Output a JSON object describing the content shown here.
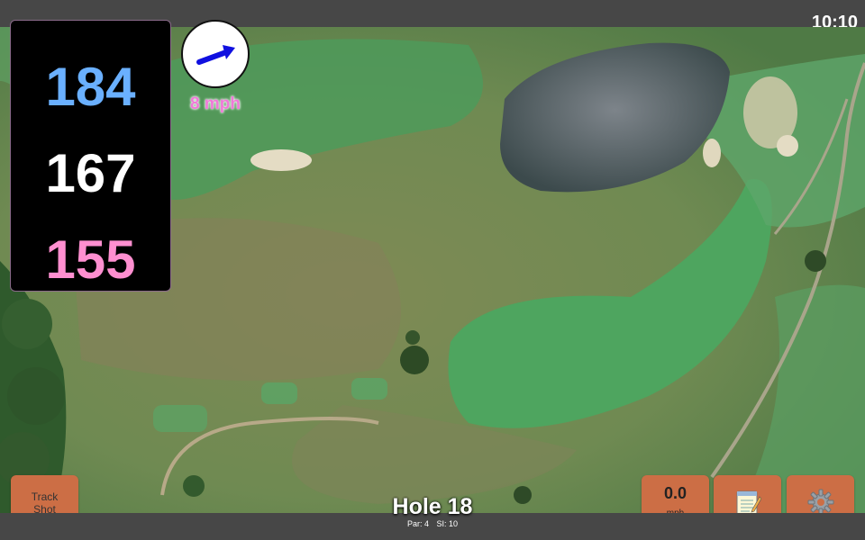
{
  "status": {
    "time": "10:10"
  },
  "distances": {
    "back": "184",
    "middle": "167",
    "front": "155"
  },
  "wind": {
    "speed_label": "8 mph",
    "arrow_icon": "wind-arrow-icon"
  },
  "hole": {
    "title": "Hole 18",
    "par": "Par: 4",
    "si": "SI: 10"
  },
  "buttons": {
    "track_shot": {
      "line1": "Track",
      "line2": "Shot"
    },
    "wind_speed": {
      "value": "0.0",
      "unit": "mph"
    },
    "notes": {
      "icon": "notepad-icon"
    },
    "settings": {
      "icon": "gear-icon"
    }
  },
  "colors": {
    "back_distance": "#6ab0ff",
    "middle_distance": "#ffffff",
    "front_distance": "#ff8fd0",
    "wind_text": "#f07ad8",
    "button": "#cc6e45"
  }
}
